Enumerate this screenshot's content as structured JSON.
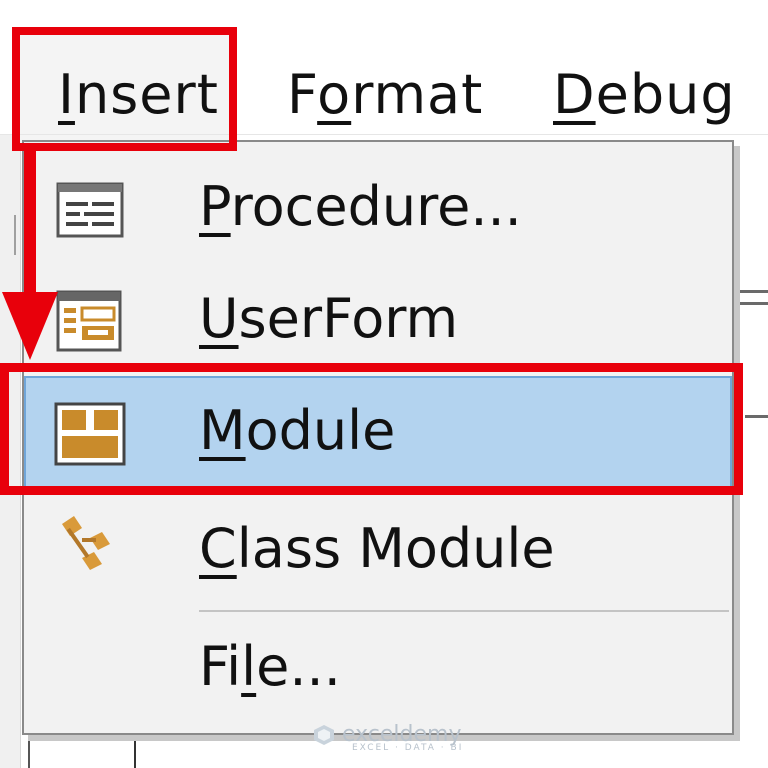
{
  "menubar": {
    "items": [
      {
        "label_pre": "",
        "label_ul": "I",
        "label_post": "nsert"
      },
      {
        "label_pre": "F",
        "label_ul": "o",
        "label_post": "rmat"
      },
      {
        "label_pre": "",
        "label_ul": "D",
        "label_post": "ebug"
      }
    ]
  },
  "insert_menu": {
    "items": [
      {
        "label_ul": "P",
        "label_post": "rocedure...",
        "icon": "procedure-icon"
      },
      {
        "label_ul": "U",
        "label_post": "serForm",
        "icon": "userform-icon"
      },
      {
        "label_ul": "M",
        "label_post": "odule",
        "icon": "module-icon",
        "highlighted": true
      },
      {
        "label_ul": "C",
        "label_post": "lass Module",
        "icon": "class-module-icon"
      },
      {
        "label_pre": "Fi",
        "label_ul": "l",
        "label_post": "e...",
        "icon": ""
      }
    ]
  },
  "annotation_color": "#e8000b",
  "highlight_color": "#b3d3ef",
  "watermark": {
    "name": "exceldemy",
    "tagline": "EXCEL · DATA · BI"
  }
}
